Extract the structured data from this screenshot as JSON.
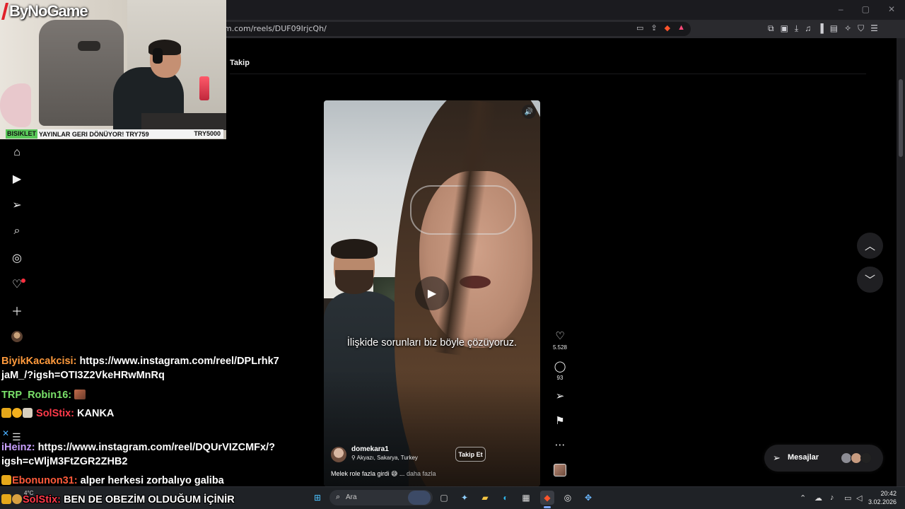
{
  "browser": {
    "url": "m.com/reels/DUF09IrjcQh/",
    "window_controls": [
      "–",
      "▢",
      "✕"
    ]
  },
  "page": {
    "tab_label": "Takip"
  },
  "webcam": {
    "brand": "ByNoGame",
    "ticker_tag": "BISIKLET",
    "ticker_text": "YAYINLAR GERI DÖNÜYOR!",
    "ticker_code": "TRY759",
    "ticker_right": "TRY5000"
  },
  "reel": {
    "caption": "İlişkide sorunları biz böyle çözüyoruz.",
    "author": "domekara1",
    "location": "Akyazı, Sakarya, Turkey",
    "follow_label": "Takip Et",
    "description": "Melek role fazla girdi 😅 ...",
    "more_label": "daha fazla",
    "likes": "5.528",
    "comments": "93"
  },
  "messages": {
    "label": "Mesajlar"
  },
  "chat": [
    {
      "user": "BiyikKacakcisi:",
      "text": "https://www.instagram.com/reel/DPLrhk7",
      "cont": "jaM_/?igsh=OTI3Z2VkeHRwMnRq"
    },
    {
      "user": "TRP_Robin16:",
      "text": ""
    },
    {
      "user": "SolStix:",
      "text": "KANKA"
    },
    {
      "user": "iHeinz:",
      "text": "https://www.instagram.com/reel/DQUrVIZCMFx/?",
      "cont": "igsh=cWljM3FtZGR2ZHB2"
    },
    {
      "user": "Ebonunon31:",
      "text": "alper herkesi zorbalıyo galiba"
    },
    {
      "user": "SolStix:",
      "text": "BEN DE OBEZİM OLDUĞUM İÇİNİR"
    }
  ],
  "taskbar": {
    "search_placeholder": "Ara",
    "weather": "4°C",
    "time": "20:42",
    "date": "3.02.2026"
  },
  "colors": {
    "accent_blue": "#4ab0ff",
    "notification_red": "#ff3040",
    "ticker_green": "#5ac85a"
  }
}
